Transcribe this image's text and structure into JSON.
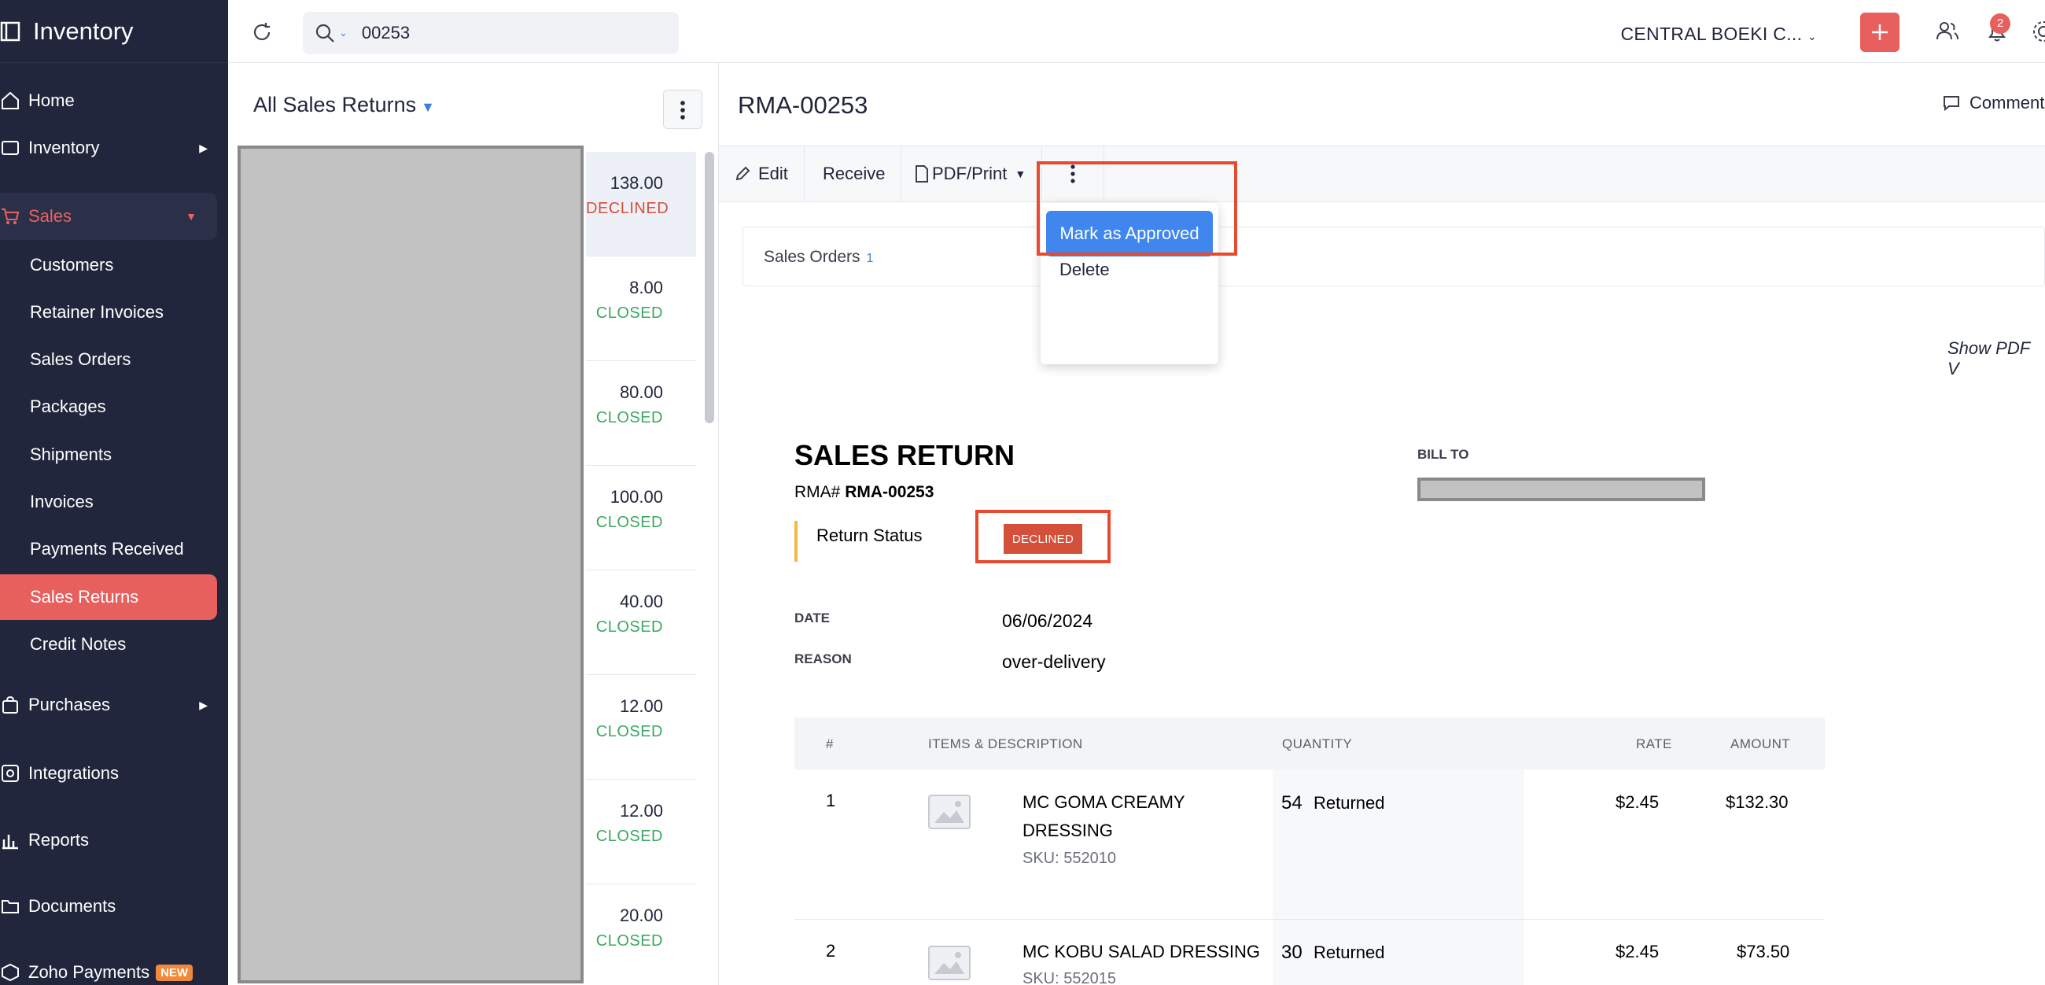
{
  "app": {
    "name": "Inventory"
  },
  "sidebar": {
    "home": "Home",
    "inventory": "Inventory",
    "sales": "Sales",
    "sales_items": [
      "Customers",
      "Retainer Invoices",
      "Sales Orders",
      "Packages",
      "Shipments",
      "Invoices",
      "Payments Received",
      "Sales Returns",
      "Credit Notes"
    ],
    "purchases": "Purchases",
    "integrations": "Integrations",
    "reports": "Reports",
    "documents": "Documents",
    "zoho_payments": "Zoho Payments",
    "new_badge": "NEW"
  },
  "topbar": {
    "search_value": "00253",
    "org_name": "CENTRAL BOEKI C...",
    "notification_count": "2"
  },
  "list": {
    "title": "All Sales Returns",
    "rows": [
      {
        "amount": "138.00",
        "status": "DECLINED"
      },
      {
        "amount": "8.00",
        "status": "CLOSED"
      },
      {
        "amount": "80.00",
        "status": "CLOSED"
      },
      {
        "amount": "100.00",
        "status": "CLOSED"
      },
      {
        "amount": "40.00",
        "status": "CLOSED"
      },
      {
        "amount": "12.00",
        "status": "CLOSED"
      },
      {
        "amount": "12.00",
        "status": "CLOSED"
      },
      {
        "amount": "20.00",
        "status": "CLOSED"
      }
    ]
  },
  "detail": {
    "title": "RMA-00253",
    "comments": "Comment",
    "toolbar": {
      "edit": "Edit",
      "receive": "Receive",
      "pdf_print": "PDF/Print"
    },
    "menu": {
      "approve": "Mark as Approved",
      "delete": "Delete"
    },
    "tab": {
      "label": "Sales Orders",
      "count": "1"
    },
    "show_pdf": "Show PDF V"
  },
  "document": {
    "heading": "SALES RETURN",
    "rma_label": "RMA#",
    "rma_number": "RMA-00253",
    "return_status_label": "Return Status",
    "return_status": "DECLINED",
    "bill_to_label": "BILL TO",
    "date_label": "DATE",
    "date": "06/06/2024",
    "reason_label": "REASON",
    "reason": "over-delivery",
    "table_headers": {
      "num": "#",
      "items": "ITEMS & DESCRIPTION",
      "qty": "QUANTITY",
      "rate": "RATE",
      "amount": "AMOUNT"
    },
    "items": [
      {
        "num": "1",
        "name_line1": "MC GOMA CREAMY",
        "name_line2": "DRESSING",
        "sku": "SKU: 552010",
        "qty": "54",
        "qty_label": "Returned",
        "rate": "$2.45",
        "amount": "$132.30"
      },
      {
        "num": "2",
        "name_line1": "MC KOBU SALAD DRESSING",
        "name_line2": "",
        "sku": "SKU: 552015",
        "qty": "30",
        "qty_label": "Returned",
        "rate": "$2.45",
        "amount": "$73.50"
      }
    ]
  },
  "colors": {
    "sidebar_bg": "#21263c",
    "accent_red": "#e8605e",
    "declined": "#d5503a",
    "closed": "#3aa860",
    "primary_blue": "#3f86ee"
  }
}
